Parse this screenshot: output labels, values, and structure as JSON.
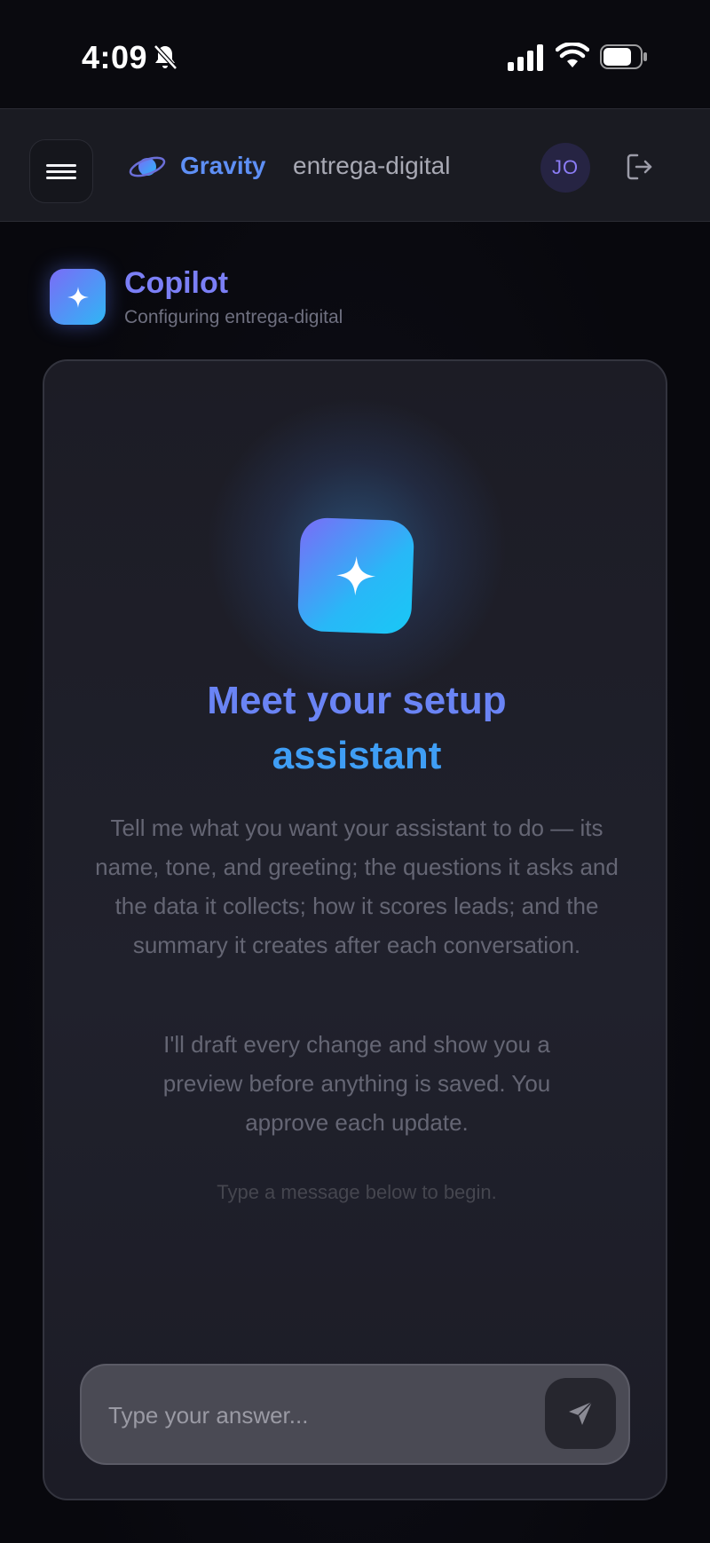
{
  "status_bar": {
    "time": "4:09",
    "icons": [
      "bell-slash-icon",
      "signal-icon",
      "wifi-icon",
      "battery-icon"
    ]
  },
  "header": {
    "menu_icon": "hamburger-icon",
    "logo_icon": "planet-icon",
    "brand": "Gravity",
    "workspace": "entrega-digital",
    "avatar_initials": "JO",
    "logout_icon": "logout-icon"
  },
  "copilot": {
    "icon": "sparkle-icon",
    "title": "Copilot",
    "subtitle": "Configuring entrega-digital"
  },
  "card": {
    "hero_icon": "sparkle-icon",
    "title_line1": "Meet your setup",
    "title_line2": "assistant",
    "paragraph1": "Tell me what you want your assistant to do — its name, tone, and greeting; the questions it asks and the data it collects; how it scores leads; and the summary it creates after each conversation.",
    "paragraph2": "I'll draft every change and show you a preview before anything is saved. You approve each update.",
    "hint": "Type a message below to begin."
  },
  "composer": {
    "placeholder": "Type your answer...",
    "value": "",
    "send_icon": "send-icon"
  },
  "colors": {
    "accent_purple": "#7a6cf7",
    "accent_cyan": "#28b8f7",
    "background": "#08080d"
  }
}
